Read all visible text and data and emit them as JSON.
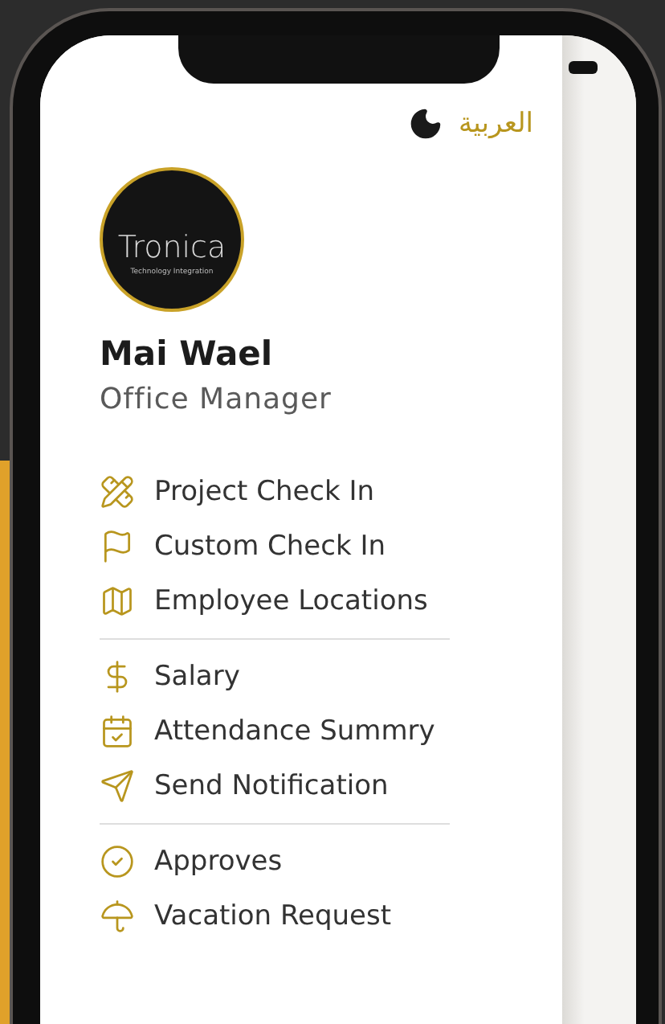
{
  "drawer": {
    "language_toggle": "العربية",
    "logo": {
      "name": "Tronica",
      "tagline": "Technology Integration"
    },
    "profile": {
      "name": "Mai Wael",
      "role": "Office Manager"
    },
    "menu_sections": [
      [
        "Project Check In",
        "Custom Check In",
        "Employee Locations"
      ],
      [
        "Salary",
        "Attendance Summry",
        "Send Notification"
      ],
      [
        "Approves",
        "Vacation Request"
      ]
    ]
  }
}
